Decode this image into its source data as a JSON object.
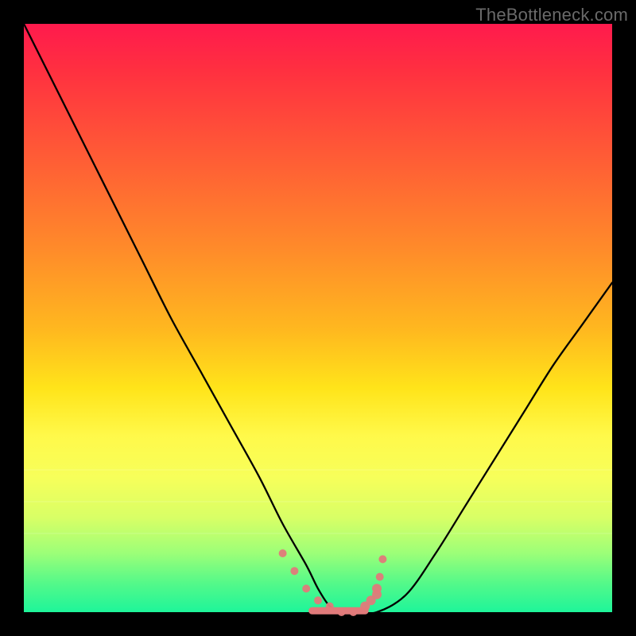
{
  "watermark": "TheBottleneck.com",
  "colors": {
    "frame": "#000000",
    "curve": "#000000",
    "marker": "#e07a7a"
  },
  "chart_data": {
    "type": "line",
    "title": "",
    "xlabel": "",
    "ylabel": "",
    "xlim": [
      0,
      100
    ],
    "ylim": [
      0,
      100
    ],
    "grid": false,
    "legend": false,
    "series": [
      {
        "name": "bottleneck-curve",
        "x": [
          0,
          5,
          10,
          15,
          20,
          25,
          30,
          35,
          40,
          44,
          48,
          50,
          52,
          54,
          56,
          60,
          65,
          70,
          75,
          80,
          85,
          90,
          95,
          100
        ],
        "y": [
          100,
          90,
          80,
          70,
          60,
          50,
          41,
          32,
          23,
          15,
          8,
          4,
          1,
          0,
          0,
          0,
          3,
          10,
          18,
          26,
          34,
          42,
          49,
          56
        ]
      }
    ],
    "markers": {
      "name": "highlight-points",
      "x": [
        44,
        46,
        48,
        50,
        52,
        54,
        56,
        58,
        59,
        60,
        60,
        60.5,
        61
      ],
      "y": [
        10,
        7,
        4,
        2,
        1,
        0,
        0,
        1,
        2,
        3,
        4,
        6,
        9
      ]
    }
  }
}
